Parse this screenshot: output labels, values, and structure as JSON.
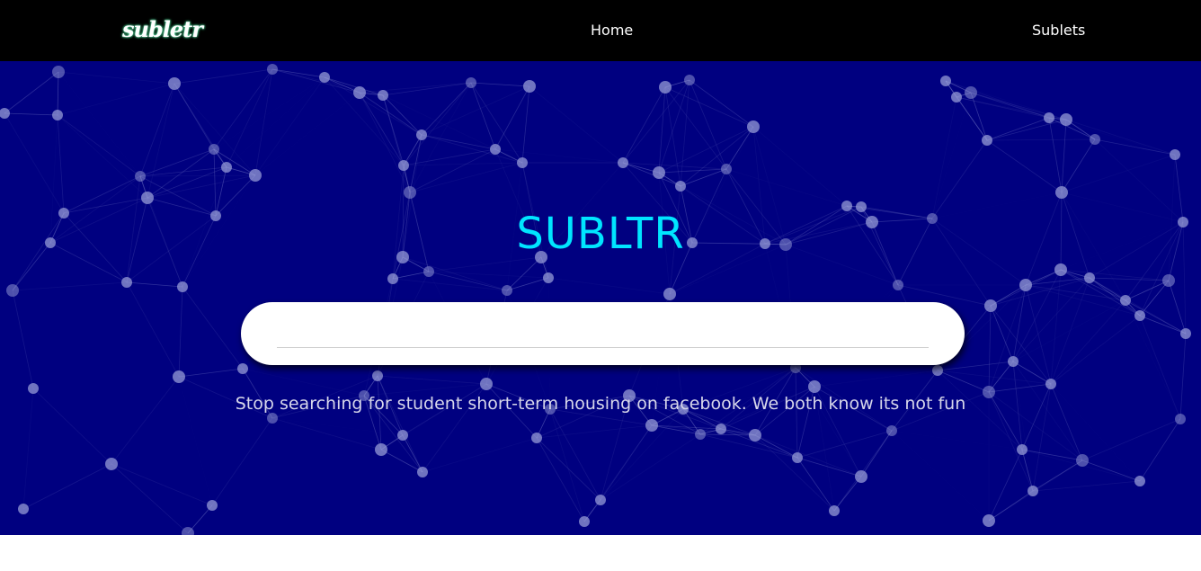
{
  "navbar": {
    "logo_text": "subletr",
    "links": [
      {
        "label": "Home"
      },
      {
        "label": "Sublets"
      }
    ]
  },
  "hero": {
    "title": "SUBLTR",
    "search": {
      "value": "",
      "placeholder": ""
    },
    "tagline": "Stop searching for student short-term housing on facebook. We both know its not fun"
  },
  "colors": {
    "navbar_bg": "#000000",
    "hero_bg": "#000080",
    "title": "#00e5ff",
    "tagline": "#d6d6ea",
    "network_nodes": "#9aa0d8"
  }
}
